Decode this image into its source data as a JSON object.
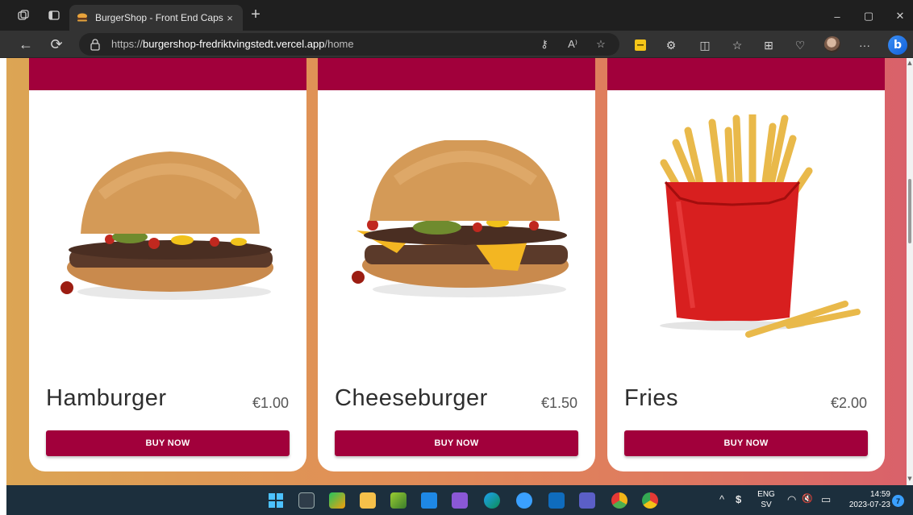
{
  "browser": {
    "tab": {
      "title": "BurgerShop - Front End Capston",
      "close": "×",
      "favicon": "burger-favicon-icon"
    },
    "new_tab": "+",
    "window_controls": {
      "minimize": "–",
      "maximize": "▢",
      "close": "✕"
    },
    "nav": {
      "back": "←",
      "refresh": "⟳"
    },
    "url": {
      "scheme": "https://",
      "host": "burgershop-fredriktvingstedt.vercel.app",
      "path": "/home"
    },
    "url_icons": {
      "key": "⚷",
      "read_aloud": "A⁾",
      "favorite": "☆"
    },
    "toolbar": {
      "extensions": "⚙",
      "split": "◫",
      "favorites": "☆",
      "collections": "⊞",
      "health": "♡",
      "more": "···",
      "bing": "b"
    }
  },
  "products": [
    {
      "name": "Hamburger",
      "price": "€1.00",
      "buy_label": "BUY NOW"
    },
    {
      "name": "Cheeseburger",
      "price": "€1.50",
      "buy_label": "BUY NOW"
    },
    {
      "name": "Fries",
      "price": "€2.00",
      "buy_label": "BUY NOW"
    }
  ],
  "taskbar": {
    "apps": [
      "start",
      "flux",
      "snip",
      "explorer",
      "notepad",
      "vscode",
      "visual-studio",
      "edge",
      "cortana",
      "outlook",
      "teams",
      "chrome-canary",
      "chrome"
    ],
    "tray": {
      "chevron": "^",
      "currency": "$",
      "lang_top": "ENG",
      "lang_bottom": "SV",
      "wifi": "◠",
      "volume": "🔇",
      "battery": "▭"
    },
    "time": "14:59",
    "date": "2023-07-23",
    "notifications": "7"
  },
  "colors": {
    "accent": "#a1003b",
    "gradient": [
      "#dca554",
      "#d9616a"
    ],
    "taskbar": "#1c2f3d"
  }
}
